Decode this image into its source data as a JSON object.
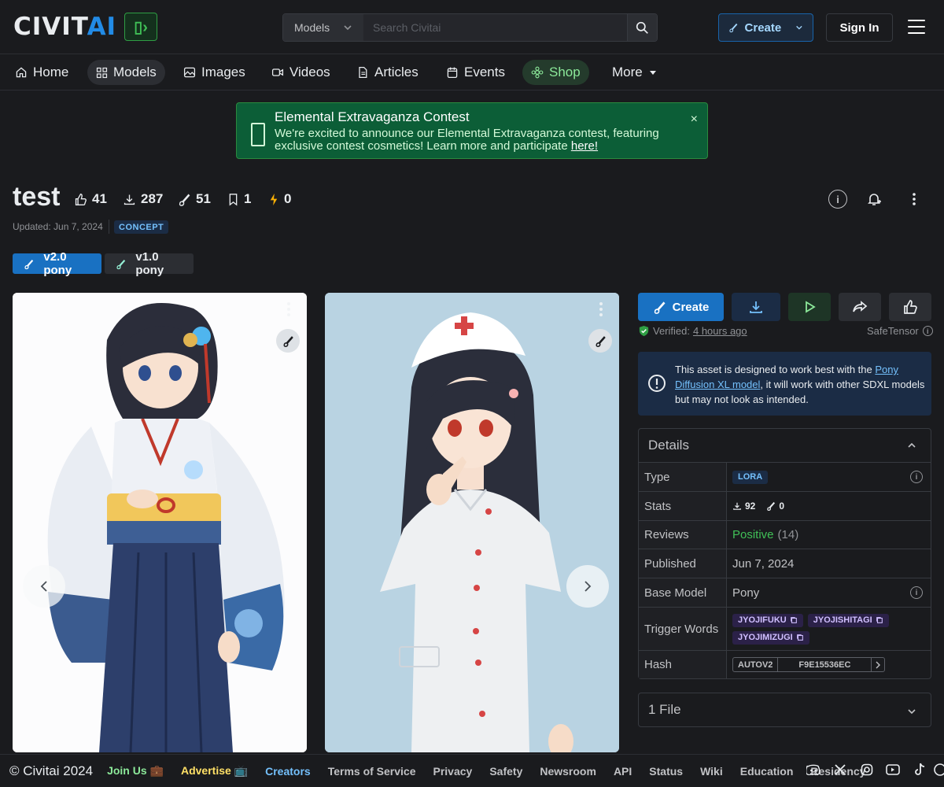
{
  "header": {
    "logo_main": "CIVIT",
    "logo_ai": "AI",
    "logo_badge": "▯›",
    "search_select": "Models",
    "search_placeholder": "Search Civitai",
    "search_shortcut": "/",
    "create_label": "Create",
    "signin_label": "Sign In"
  },
  "nav": {
    "items": [
      {
        "label": "Home",
        "icon": "home-icon"
      },
      {
        "label": "Models",
        "icon": "grid-icon"
      },
      {
        "label": "Images",
        "icon": "photo-icon"
      },
      {
        "label": "Videos",
        "icon": "video-icon"
      },
      {
        "label": "Articles",
        "icon": "file-text-icon"
      },
      {
        "label": "Events",
        "icon": "calendar-icon"
      },
      {
        "label": "Shop",
        "icon": "shop-icon"
      },
      {
        "label": "More",
        "icon": "caret-down-icon"
      }
    ]
  },
  "banner": {
    "title": "Elemental Extravaganza Contest",
    "body": "We're excited to announce our Elemental Extravaganza contest, featuring exclusive contest cosmetics! Learn more and participate ",
    "link": "here!",
    "close": "×"
  },
  "model": {
    "title": "test",
    "likes": "41",
    "downloads": "287",
    "remixes": "51",
    "collected": "1",
    "buzz": "0",
    "updated": "Updated: Jun 7, 2024",
    "category": "CONCEPT",
    "versions": [
      "v2.0 pony",
      "v1.0 pony"
    ]
  },
  "actions": {
    "create": "Create",
    "verified_label": "Verified:",
    "verified_time": "4 hours ago",
    "safetensor": "SafeTensor"
  },
  "notice": {
    "pre": "This asset is designed to work best with the ",
    "link": "Pony Diffusion XL model",
    "post": ", it will work with other SDXL models but may not look as intended."
  },
  "details": {
    "heading": "Details",
    "type_label": "Type",
    "type_value": "LORA",
    "stats_label": "Stats",
    "stats_downloads": "92",
    "stats_remixes": "0",
    "reviews_label": "Reviews",
    "reviews_value": "Positive",
    "reviews_count": "(14)",
    "published_label": "Published",
    "published_value": "Jun 7, 2024",
    "base_label": "Base Model",
    "base_value": "Pony",
    "trigger_label": "Trigger Words",
    "triggers": [
      "JYOJIFUKU",
      "JYOJISHITAGI",
      "JYOJIMIZUGI"
    ],
    "hash_label": "Hash",
    "hash_type": "AUTOV2",
    "hash_value": "F9E15536EC"
  },
  "files": {
    "label": "1 File"
  },
  "footer": {
    "copyright": "© Civitai 2024",
    "links": [
      "Join Us 💼",
      "Advertise 📺",
      "Creators",
      "Terms of Service",
      "Privacy",
      "Safety",
      "Newsroom",
      "API",
      "Status",
      "Wiki",
      "Education",
      "Residency"
    ],
    "colors": {
      "join": "#8ce99a",
      "advertise": "#ffe066",
      "creators": "#74c0fc"
    }
  },
  "colors": {
    "accent": "#1971c2",
    "background": "#1a1b1e",
    "positive": "#40c057",
    "banner_bg": "#0c5e37"
  }
}
